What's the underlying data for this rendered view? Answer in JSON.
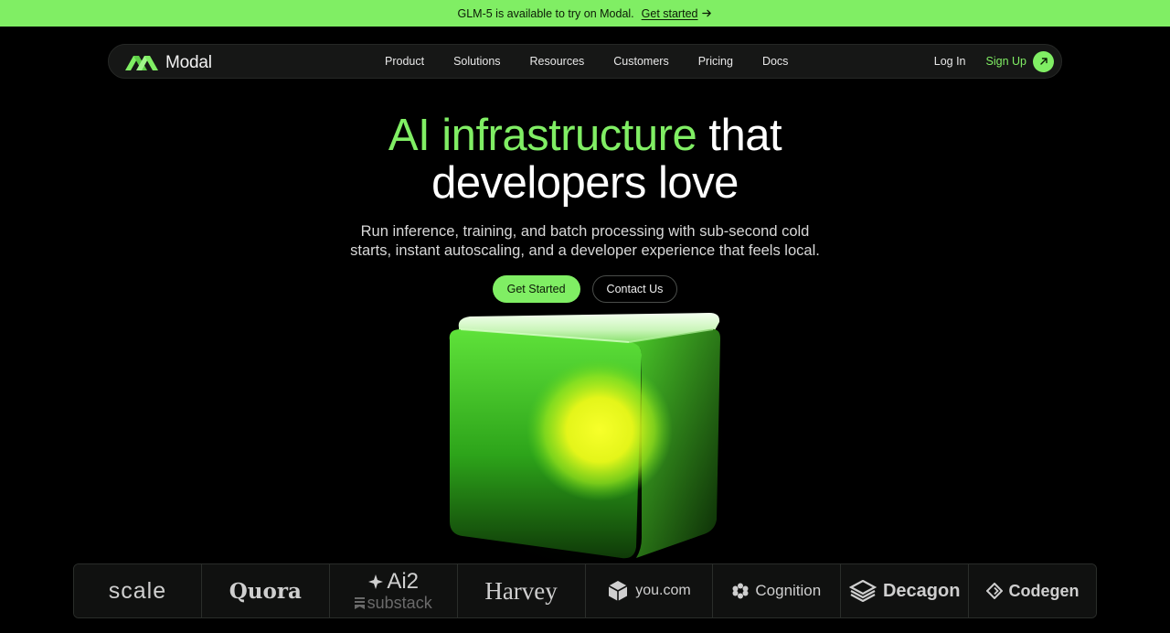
{
  "announcement": {
    "text": "GLM-5 is available to try on Modal.",
    "link": "Get started"
  },
  "nav": {
    "brand": "Modal",
    "links": [
      "Product",
      "Solutions",
      "Resources",
      "Customers",
      "Pricing",
      "Docs"
    ],
    "login": "Log In",
    "signup": "Sign Up"
  },
  "hero": {
    "headline_green": "AI infrastructure",
    "headline_white_1": "that",
    "headline_white_2": "developers love",
    "subtitle_line1": "Run inference, training, and batch processing with sub-second cold",
    "subtitle_line2": "starts, instant autoscaling, and a developer experience that feels local.",
    "primary_cta": "Get Started",
    "secondary_cta": "Contact Us"
  },
  "customers": {
    "logos": [
      "scale",
      "Quora",
      "Ai2",
      "substack",
      "Harvey",
      "you.com",
      "Cognition",
      "Decagon",
      "Codegen"
    ]
  },
  "colors": {
    "accent": "#80ee64",
    "background": "#000000",
    "nav_bg": "#161716"
  },
  "icons": {
    "announcement_link": "arrow-right-icon",
    "signup": "arrow-up-right-icon",
    "brand": "modal-logo-icon"
  }
}
